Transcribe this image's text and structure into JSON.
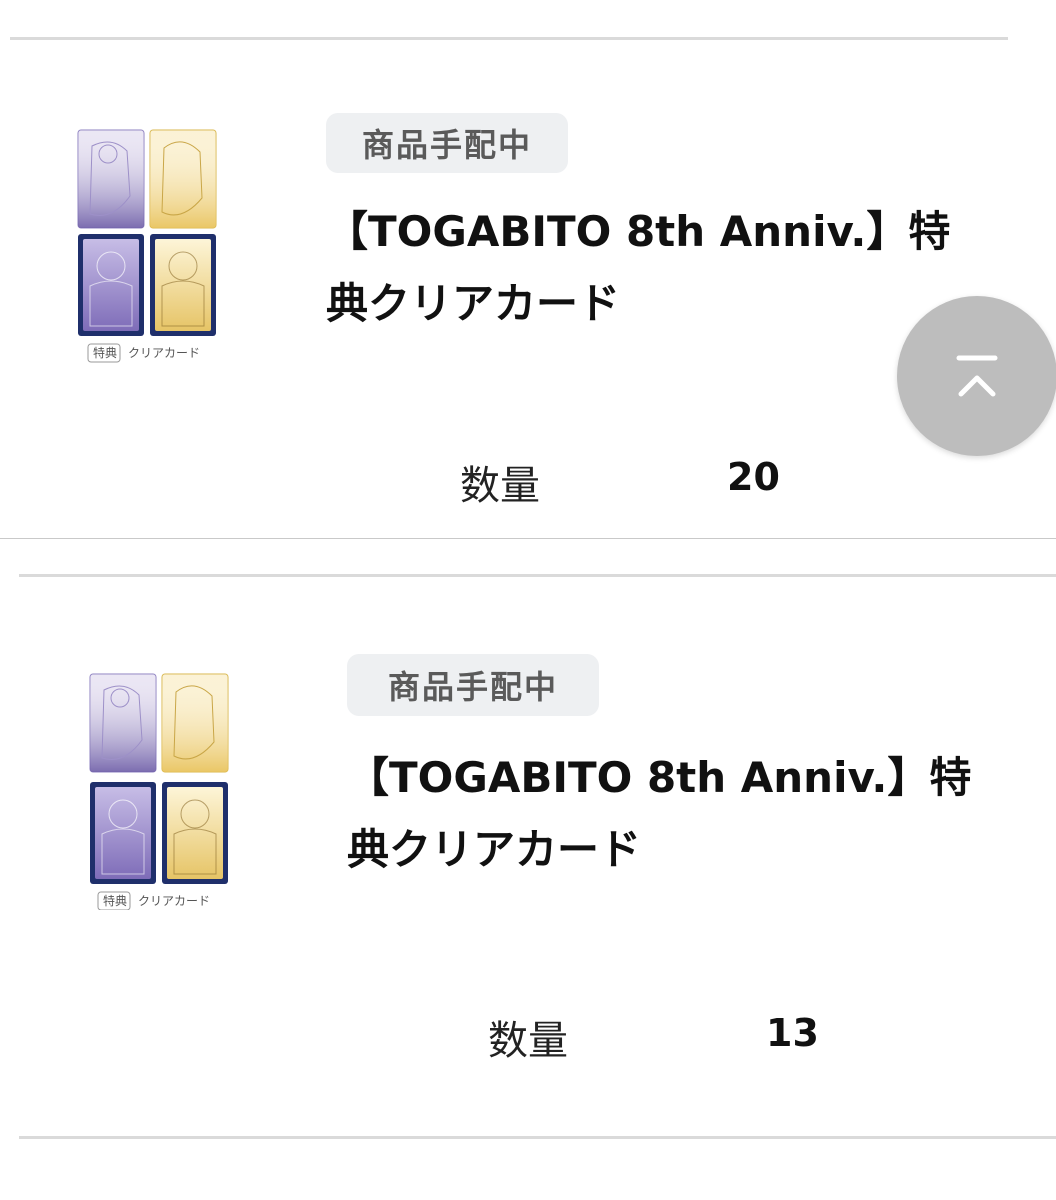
{
  "items": [
    {
      "status": "商品手配中",
      "title_line1": "【TOGABITO 8th Anniv.】特",
      "title_line2": "典クリアカード",
      "thumbnail_badge": "特典",
      "thumbnail_caption": "クリアカード",
      "quantity_label": "数量",
      "quantity_value": "20"
    },
    {
      "status": "商品手配中",
      "title_line1": "【TOGABITO 8th Anniv.】特",
      "title_line2": "典クリアカード",
      "thumbnail_badge": "特典",
      "thumbnail_caption": "クリアカード",
      "quantity_label": "数量",
      "quantity_value": "13"
    }
  ],
  "scroll_top_button": {
    "icon": "scroll-to-top-icon"
  },
  "colors": {
    "pill_background": "#eef0f2",
    "pill_text": "#5a5a5a",
    "divider": "#dadada",
    "scroll_button": "#bdbdbd",
    "card_purple": "#6f5fa8",
    "card_gold": "#e8c76a",
    "card_navy": "#1f2f6b"
  }
}
